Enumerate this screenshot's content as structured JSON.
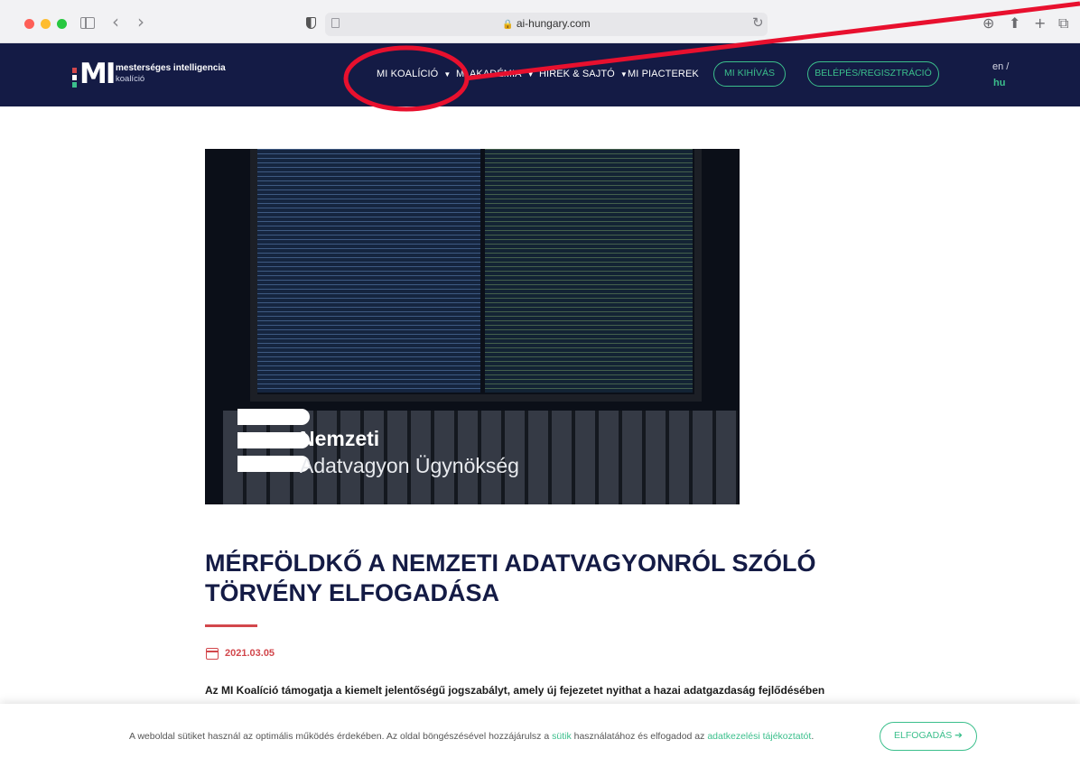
{
  "browser": {
    "url": "ai-hungary.com",
    "lock_icon": "🔒",
    "reload_icon": "↻",
    "back_icon": "‹",
    "forward_icon": "›",
    "right_icons": [
      "⊕",
      "⬆",
      "+",
      "⧉"
    ]
  },
  "header": {
    "logo_mark": "MI",
    "logo_line1": "mesterséges intelligencia",
    "logo_line2": "koalíció",
    "menu": [
      {
        "label": "MI KOALÍCIÓ",
        "caret": "▼"
      },
      {
        "label": "MI AKADÉMIA",
        "caret": "▼"
      },
      {
        "label": "HÍREK & SAJTÓ",
        "caret": "▼"
      },
      {
        "label": "MI PIACTEREK"
      }
    ],
    "cta_challenge": "MI KIHÍVÁS",
    "cta_login": "BELÉPÉS/REGISZTRÁCIÓ",
    "lang_en": "en /",
    "lang_hu": "hu"
  },
  "hero": {
    "title_line1": "Nemzeti",
    "title_line2": "Adatvagyon Ügynökség"
  },
  "article": {
    "headline": "MÉRFÖLDKŐ A NEMZETI ADATVAGYONRÓL SZÓLÓ TÖRVÉNY ELFOGADÁSA",
    "date": "2021.03.05",
    "lead": "Az MI Koalíció támogatja a kiemelt jelentőségű jogszabályt, amely új fejezetet nyithat a hazai adatgazdaság fejlődésében"
  },
  "cookie": {
    "text_part1": "A weboldal sütiket használ az optimális működés érdekében. Az oldal böngészésével hozzájárulsz a ",
    "link_cookies": "sütik",
    "text_part2": " használatához és elfogadod az ",
    "link_policy": "adatkezelési tájékoztatót",
    "text_part3": ".",
    "accept_label": "ELFOGADÁS",
    "accept_arrow": "➔"
  },
  "colors": {
    "nav_bg": "#141b45",
    "accent_green": "#3bbf8c",
    "accent_red": "#d2474c",
    "annotation_red": "#e8102e"
  }
}
